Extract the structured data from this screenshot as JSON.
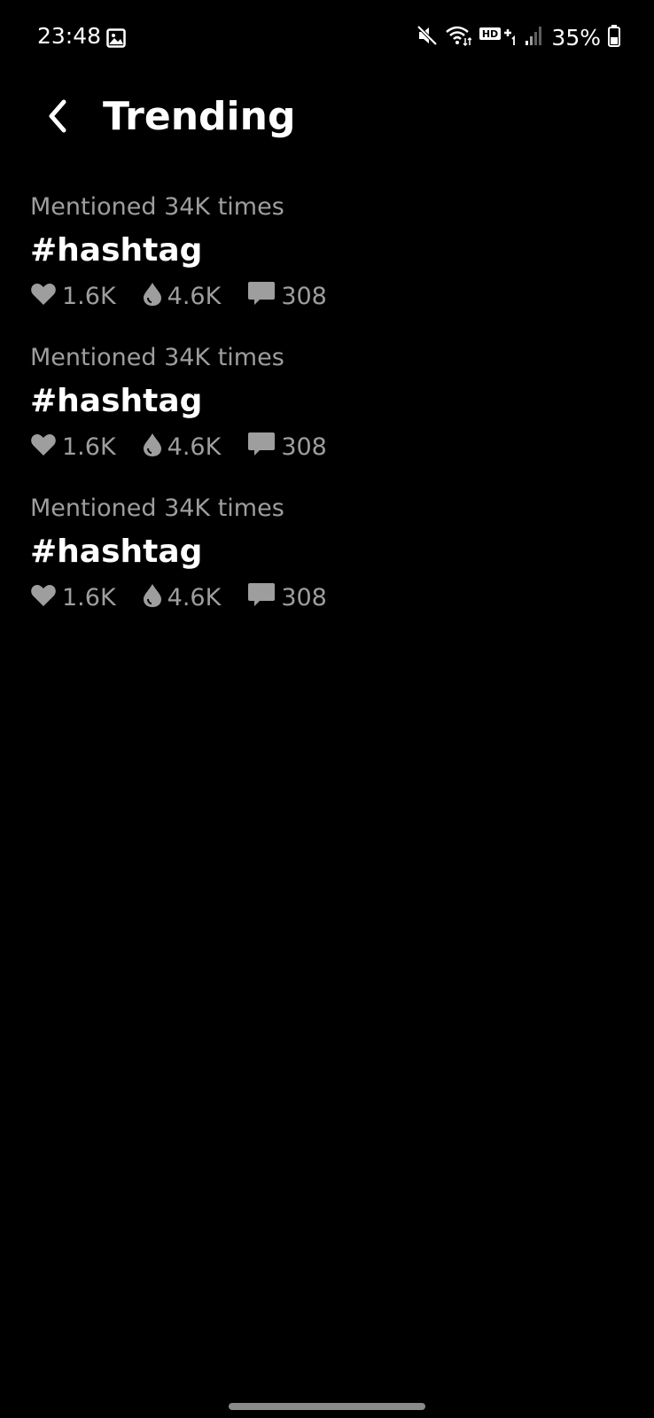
{
  "status_bar": {
    "time": "23:48",
    "battery": "35%",
    "icons": [
      "gallery-icon",
      "mute-icon",
      "wifi-icon",
      "hd-voice-icon",
      "signal-icon",
      "battery-icon"
    ]
  },
  "header": {
    "title": "Trending",
    "back_icon": "chevron-left-icon"
  },
  "trends": [
    {
      "mentioned": "Mentioned 34K times",
      "hashtag": "#hashtag",
      "likes": "1.6K",
      "drops": "4.6K",
      "comments": "308"
    },
    {
      "mentioned": "Mentioned 34K times",
      "hashtag": "#hashtag",
      "likes": "1.6K",
      "drops": "4.6K",
      "comments": "308"
    },
    {
      "mentioned": "Mentioned 34K times",
      "hashtag": "#hashtag",
      "likes": "1.6K",
      "drops": "4.6K",
      "comments": "308"
    }
  ],
  "colors": {
    "background": "#000000",
    "primary_text": "#ffffff",
    "secondary_text": "#9e9e9e"
  }
}
